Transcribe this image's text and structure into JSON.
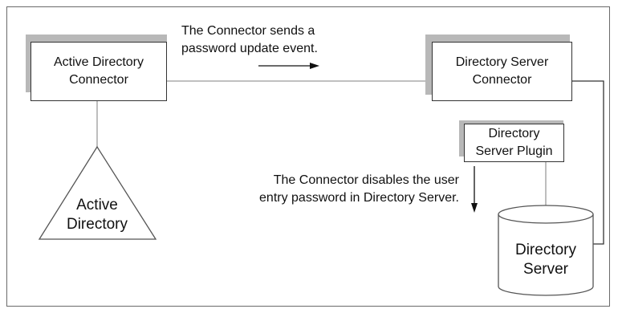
{
  "nodes": {
    "ad_connector": {
      "line1": "Active Directory",
      "line2": "Connector"
    },
    "ds_connector": {
      "line1": "Directory Server",
      "line2": "Connector"
    },
    "ds_plugin": {
      "line1": "Directory",
      "line2": "Server Plugin"
    },
    "active_directory": {
      "line1": "Active",
      "line2": "Directory"
    },
    "directory_server": {
      "line1": "Directory",
      "line2": "Server"
    }
  },
  "annotations": {
    "top": {
      "line1": "The Connector sends a",
      "line2": "password update event."
    },
    "middle": {
      "line1": "The Connector disables the user",
      "line2": "entry password in Directory Server."
    }
  }
}
